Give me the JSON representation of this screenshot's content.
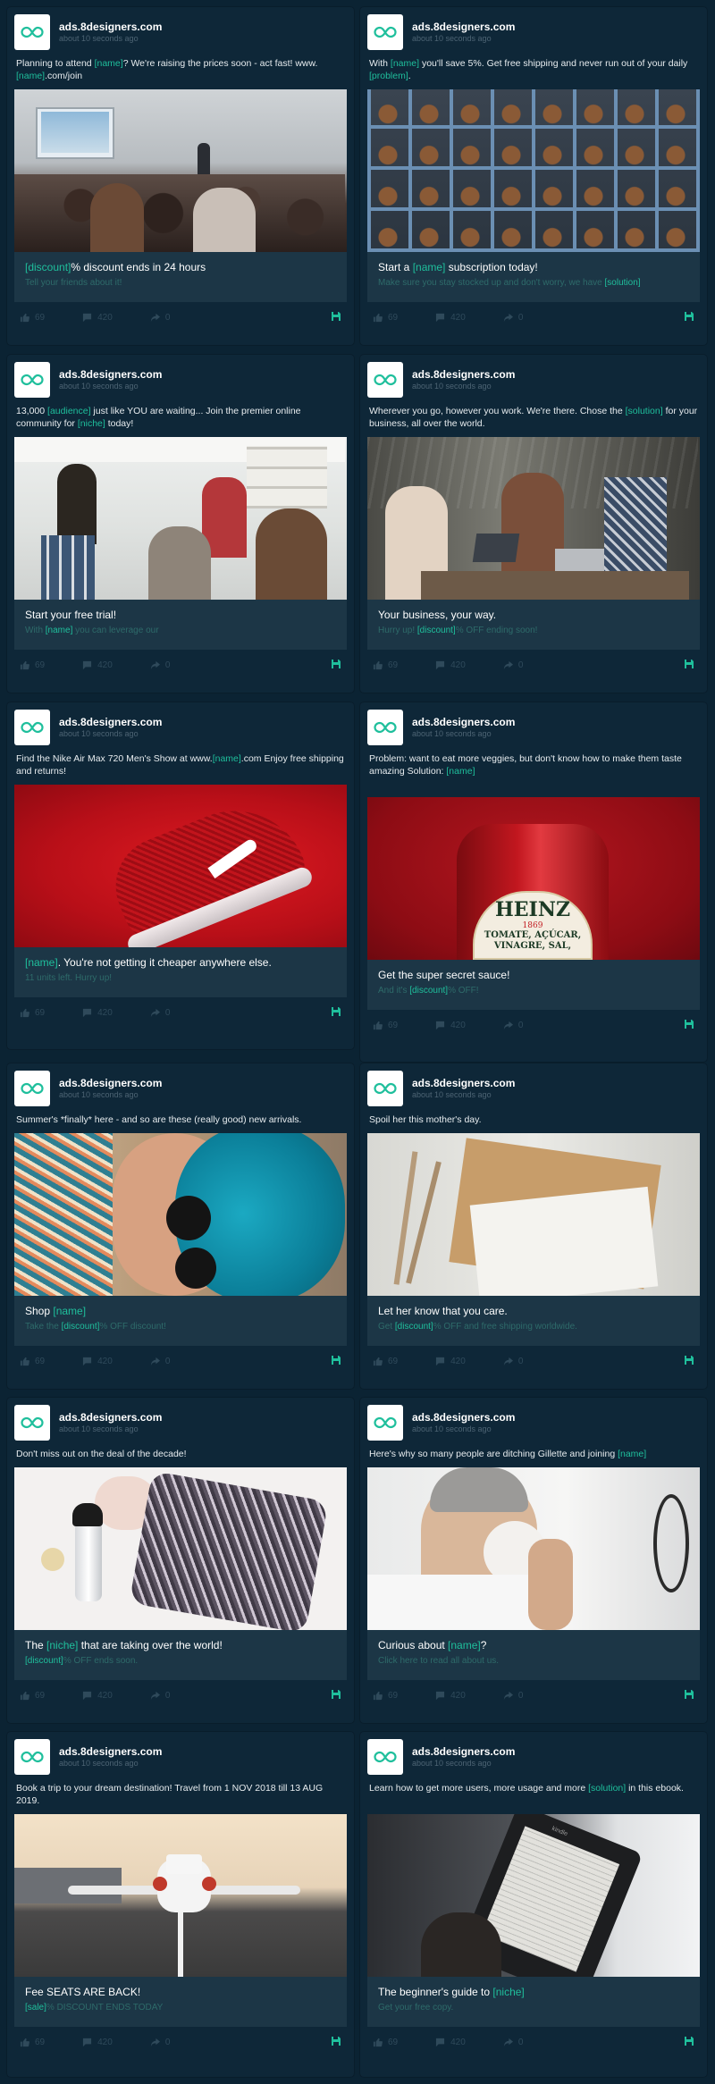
{
  "brand": {
    "domain": "ads.8designers.com",
    "time": "about 10 seconds ago",
    "accent": "#1fbf9c"
  },
  "stats": {
    "likes": "69",
    "comments": "420",
    "shares": "0"
  },
  "cards": [
    {
      "text_parts": [
        "Planning to attend ",
        "[name]",
        "? We're raising the prices soon - act fast! www.",
        "[name]",
        ".com/join"
      ],
      "headline_parts": [
        "[discount]",
        "% discount ends in 24 hours"
      ],
      "subline_parts": [
        "Tell your friends about it!"
      ],
      "image": "conference-audience-photo"
    },
    {
      "text_parts": [
        "With ",
        "[name]",
        " you'll save 5%. Get free shipping and never run out of your daily ",
        "[problem]",
        "."
      ],
      "headline_parts": [
        "Start a ",
        "[name]",
        " subscription today!"
      ],
      "subline_parts": [
        "Make sure you stay stocked up and don't worry, we have ",
        "[solution]"
      ],
      "image": "jar-shelves-photo"
    },
    {
      "text_parts": [
        "13,000 ",
        "[audience]",
        " just like YOU are waiting... Join the premier online community for ",
        "[niche]",
        " today!"
      ],
      "headline_parts": [
        "Start your free trial!"
      ],
      "subline_parts": [
        "With ",
        "[name]",
        " you can leverage our"
      ],
      "image": "team-meeting-photo"
    },
    {
      "text_parts": [
        "Wherever you go, however you work. We're there. Chose the ",
        "[solution]",
        " for your business, all over the world."
      ],
      "headline_parts": [
        "Your business, your way."
      ],
      "subline_parts": [
        "Hurry up! ",
        "[discount]",
        "% OFF ending soon!"
      ],
      "image": "coworkers-laptop-photo"
    },
    {
      "text_parts": [
        "Find the Nike Air Max 720 Men's Show at www.",
        "[name]",
        ".com Enjoy free shipping and returns!"
      ],
      "headline_parts": [
        "[name]",
        ". You're not getting it cheaper anywhere else."
      ],
      "subline_parts": [
        "11 units left. Hurry up!"
      ],
      "image": "red-sneaker-photo"
    },
    {
      "text_parts": [
        "Problem: want to eat more veggies, but don't know how to make them taste amazing Solution: ",
        "[name]"
      ],
      "headline_parts": [
        "Get the super secret sauce!"
      ],
      "subline_parts": [
        "And it's ",
        "[discount]",
        "% OFF!"
      ],
      "image": "ketchup-bottle-photo",
      "label_brand": "HEINZ",
      "label_year": "1869",
      "label_line1": "TOMATE, AÇÚCAR,",
      "label_line2": "VINAGRE, SAL,"
    },
    {
      "text_parts": [
        "Summer's *finally* here - and so are these (really good) new arrivals."
      ],
      "headline_parts": [
        "Shop ",
        "[name]"
      ],
      "subline_parts": [
        "Take the ",
        "[discount]",
        "% OFF discount!"
      ],
      "image": "blue-hair-sunglasses-photo"
    },
    {
      "text_parts": [
        "Spoil her this mother's day."
      ],
      "headline_parts": [
        "Let her know that you care."
      ],
      "subline_parts": [
        "Get ",
        "[discount]",
        "% OFF and free shipping worldwide."
      ],
      "image": "envelope-photo"
    },
    {
      "text_parts": [
        "Don't miss out on the deal of the decade!"
      ],
      "headline_parts": [
        "The ",
        "[niche]",
        " that are taking over the world!"
      ],
      "subline_parts": [
        "[discount]",
        "% OFF ends soon."
      ],
      "image": "cosmetics-fabric-photo"
    },
    {
      "text_parts": [
        "Here's why so many people are ditching Gillette and joining ",
        "[name]"
      ],
      "headline_parts": [
        "Curious about ",
        "[name]",
        "?"
      ],
      "subline_parts": [
        "Click here to read all about us."
      ],
      "image": "man-shaving-photo"
    },
    {
      "text_parts": [
        "Book a trip to your dream destination! Travel from 1 NOV 2018 till 13 AUG 2019."
      ],
      "headline_parts": [
        "Fee SEATS ARE BACK!"
      ],
      "subline_parts": [
        "[sale]",
        "% DISCOUNT ENDS TODAY"
      ],
      "image": "airplane-runway-photo"
    },
    {
      "text_parts": [
        "Learn how to get more users, more usage and more ",
        "[solution]",
        " in this ebook."
      ],
      "headline_parts": [
        "The beginner's guide to ",
        "[niche]"
      ],
      "subline_parts": [
        "Get your free copy."
      ],
      "image": "ereader-photo",
      "ereader_brand": "kindle"
    }
  ]
}
